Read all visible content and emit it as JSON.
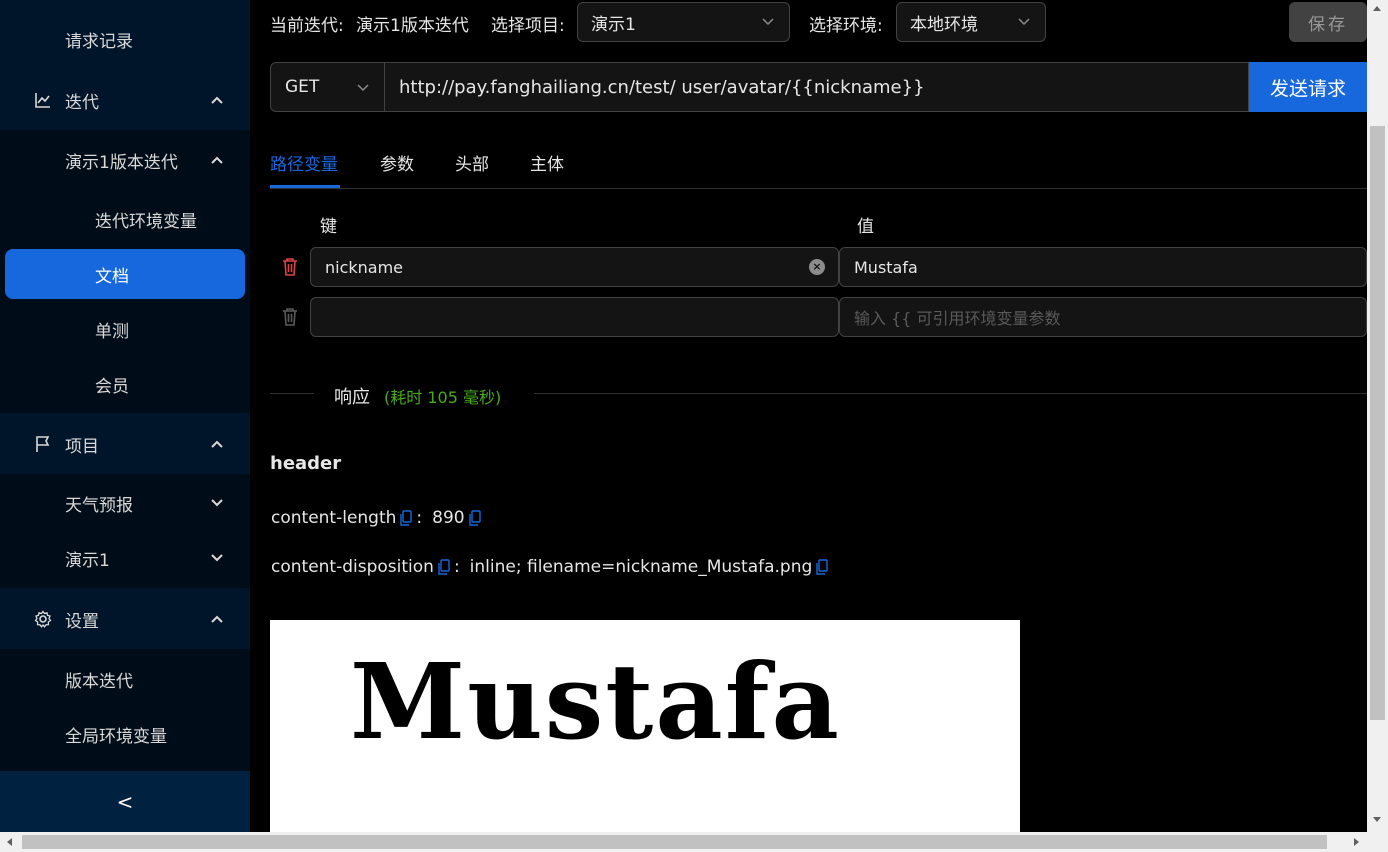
{
  "sidebar": {
    "request_log": "请求记录",
    "iteration": "迭代",
    "demo_iteration": "演示1版本迭代",
    "iter_env_vars": "迭代环境变量",
    "docs": "文档",
    "unit_test": "单测",
    "member": "会员",
    "project": "项目",
    "weather": "天气预报",
    "demo1": "演示1",
    "settings": "设置",
    "version_iter": "版本迭代",
    "global_env_vars": "全局环境变量",
    "collapse_glyph": "<"
  },
  "topbar": {
    "current_iteration_label": "当前迭代:",
    "current_iteration_value": "演示1版本迭代",
    "select_project_label": "选择项目:",
    "project_value": "演示1",
    "select_env_label": "选择环境:",
    "env_value": "本地环境",
    "save_label": "保存"
  },
  "request": {
    "method": "GET",
    "url": "http://pay.fanghailiang.cn/test/ user/avatar/{{nickname}}",
    "send_label": "发送请求"
  },
  "tabs": [
    {
      "label": "路径变量",
      "active": true
    },
    {
      "label": "参数",
      "active": false
    },
    {
      "label": "头部",
      "active": false
    },
    {
      "label": "主体",
      "active": false
    }
  ],
  "path_vars": {
    "key_header": "键",
    "value_header": "值",
    "rows": [
      {
        "key": "nickname",
        "value": "Mustafa"
      },
      {
        "key": "",
        "value": "",
        "value_placeholder": "输入 {{ 可引用环境变量参数"
      }
    ]
  },
  "response": {
    "title": "响应",
    "time_text": "(耗时 105 毫秒)",
    "header_title": "header",
    "headers": [
      {
        "name": "content-length",
        "value": "890"
      },
      {
        "name": "content-disposition",
        "value": "inline; filename=nickname_Mustafa.png"
      }
    ],
    "preview_text": "Mustafa"
  },
  "colors": {
    "accent": "#1668dc",
    "sidebar_bg": "#001529",
    "success": "#49aa19",
    "danger": "#dc4446"
  }
}
